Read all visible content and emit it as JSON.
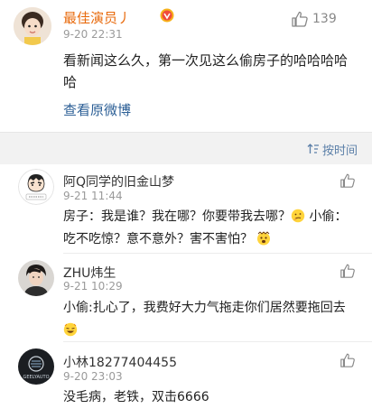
{
  "main_post": {
    "author": "最佳演员丿",
    "time": "9-20 22:31",
    "like_count": "139",
    "content": "看新闻这么久，第一次见这么偷房子的哈哈哈哈哈",
    "view_original": "查看原微博"
  },
  "sort": {
    "label": "按时间",
    "icon": "sort-icon"
  },
  "comments": [
    {
      "name": "阿Q同学的旧金山梦",
      "time": "9-21 11:44",
      "text_parts": [
        "房子：我是谁？我在哪？你要带我去哪？",
        " 小偷：吃不吃惊？意不意外？害不害怕？",
        ""
      ]
    },
    {
      "name": "ZHU炜生",
      "time": "9-21 10:29",
      "text_parts": [
        "小偷:扎心了，我费好大力气拖走你们居然要拖回去",
        ""
      ]
    },
    {
      "name": "小林18277404455",
      "time": "9-20 23:03",
      "text_parts": [
        "没毛病，老铁，双击6666"
      ],
      "avatar_text": "GEELYAUTO"
    }
  ],
  "colors": {
    "author_name": "#e86b0e",
    "link": "#2c5f96",
    "sort_label": "#5b7fa8",
    "time": "#9a9a9a"
  }
}
